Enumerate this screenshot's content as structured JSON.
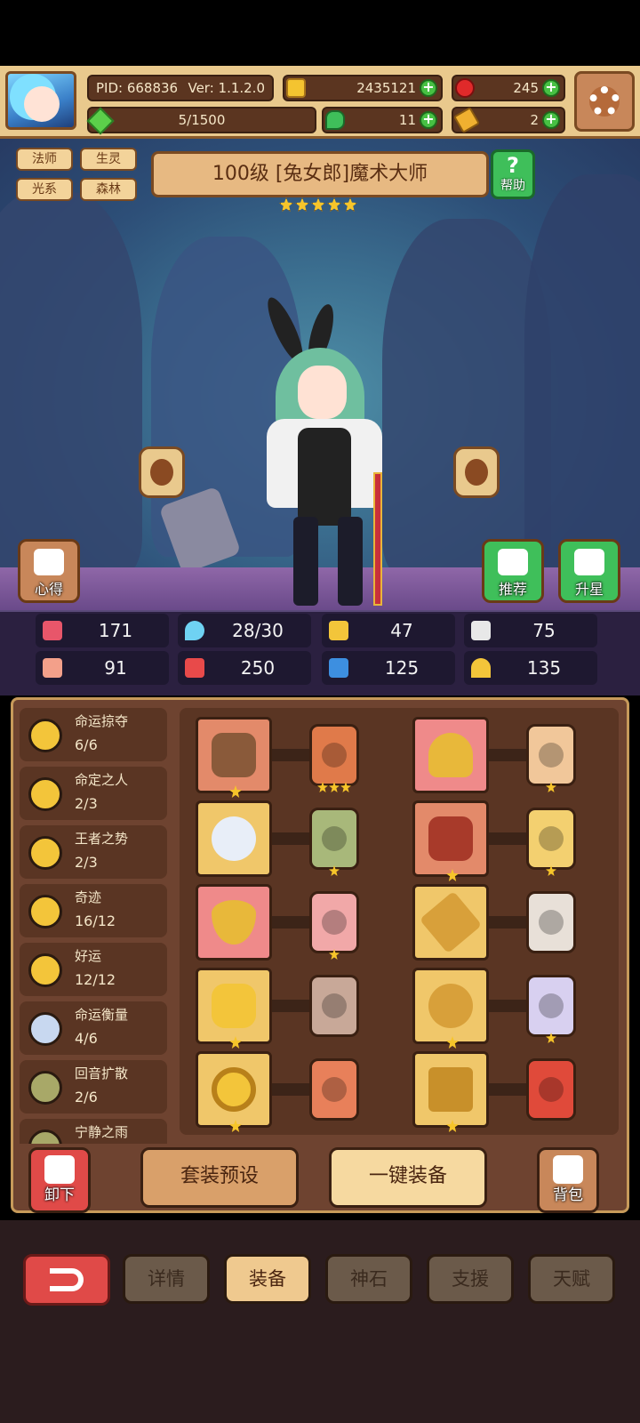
{
  "header": {
    "pid": "PID: 668836",
    "version": "Ver: 1.1.2.0",
    "gold": "2435121",
    "ruby": "245",
    "energy": "5/1500",
    "clover": "11",
    "key": "2"
  },
  "hero": {
    "tags": [
      "法师",
      "生灵",
      "光系",
      "森林"
    ],
    "title": "100级 [兔女郎]魔术大师",
    "star_count": 5,
    "help_label": "帮助",
    "buttons": {
      "insight": "心得",
      "recommend": "推荐",
      "star_up": "升星"
    }
  },
  "stats": [
    {
      "icon": "heart-icon",
      "value": "171",
      "color": "#e8566a"
    },
    {
      "icon": "mana-drop-icon",
      "value": "28/30",
      "color": "#6fd2f3"
    },
    {
      "icon": "shield-icon",
      "value": "47",
      "color": "#f3c53a"
    },
    {
      "icon": "wing-icon",
      "value": "75",
      "color": "#e8e8e8"
    },
    {
      "icon": "fist-icon",
      "value": "91",
      "color": "#f3a08a"
    },
    {
      "icon": "spellbook-icon",
      "value": "250",
      "color": "#e84a4a"
    },
    {
      "icon": "boot-icon",
      "value": "125",
      "color": "#3d8fe0"
    },
    {
      "icon": "horseshoe-icon",
      "value": "135",
      "color": "#f3c53a"
    }
  ],
  "sets": [
    {
      "name": "命运掠夺",
      "count": "6/6",
      "color": "#f3c53a"
    },
    {
      "name": "命定之人",
      "count": "2/3",
      "color": "#f3c53a"
    },
    {
      "name": "王者之势",
      "count": "2/3",
      "color": "#f3c53a"
    },
    {
      "name": "奇迹",
      "count": "16/12",
      "color": "#f3c53a"
    },
    {
      "name": "好运",
      "count": "12/12",
      "color": "#f3c53a"
    },
    {
      "name": "命运衡量",
      "count": "4/6",
      "color": "#c8d8f0"
    },
    {
      "name": "回音扩散",
      "count": "2/6",
      "color": "#a8a868"
    },
    {
      "name": "宁静之雨",
      "count": "",
      "color": "#a8a868"
    }
  ],
  "equipment": [
    {
      "slot": "staff",
      "slot_bg": "#e38a6a",
      "card_bg": "#e07a4a",
      "card_stars": 3
    },
    {
      "slot": "hat",
      "slot_bg": "#ef8a8a",
      "card_bg": "#f1c79a",
      "card_stars": 1
    },
    {
      "slot": "orb",
      "slot_bg": "#f0c76a",
      "card_bg": "#a8b87a",
      "card_stars": 1
    },
    {
      "slot": "armor",
      "slot_bg": "#e38a6a",
      "card_bg": "#f3d070",
      "card_stars": 1
    },
    {
      "slot": "necklace",
      "slot_bg": "#ef8a8a",
      "card_bg": "#f1a8a8",
      "card_stars": 1
    },
    {
      "slot": "bone-relic",
      "slot_bg": "#f0c76a",
      "card_bg": "#e8e0d8",
      "card_stars": 0
    },
    {
      "slot": "amulet",
      "slot_bg": "#f0c76a",
      "card_bg": "#c8a898",
      "card_stars": 0
    },
    {
      "slot": "ring",
      "slot_bg": "#f0c76a",
      "card_bg": "#d8d0f0",
      "card_stars": 1
    },
    {
      "slot": "gold-ring",
      "slot_bg": "#f0c76a",
      "card_bg": "#e8805a",
      "card_stars": 0
    },
    {
      "slot": "boots",
      "slot_bg": "#f0c76a",
      "card_bg": "#e04a3a",
      "card_stars": 0
    }
  ],
  "actions": {
    "unequip": "卸下",
    "preset": "套装预设",
    "auto_equip": "一键装备",
    "bag": "背包"
  },
  "tabs": [
    "详情",
    "装备",
    "神石",
    "支援",
    "天赋"
  ],
  "active_tab": "装备"
}
